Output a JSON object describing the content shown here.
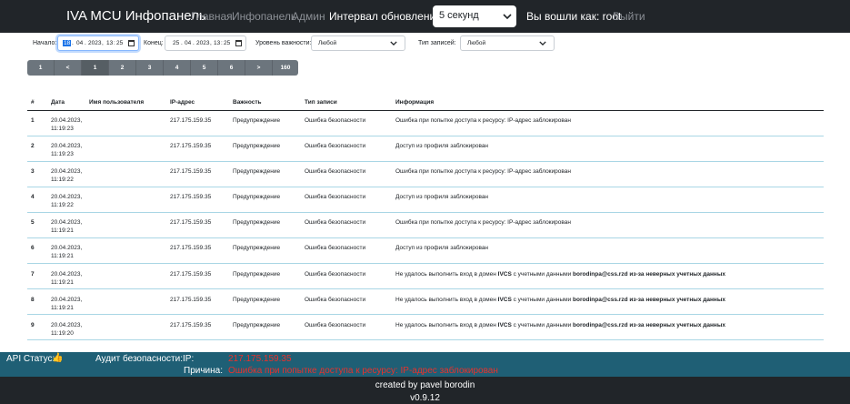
{
  "navbar": {
    "brand": "IVA MCU Инфопанель",
    "links": [
      "Главная",
      "Инфопанель",
      "Админ"
    ],
    "interval_label": "Интервал обновления:",
    "interval_value": "5 секунд",
    "logged_in": "Вы вошли как: root",
    "logout": "Выйти"
  },
  "filters": {
    "start_label": "Начало:",
    "start": {
      "day": "18",
      "month": "04",
      "year": "2023",
      "hour": "13",
      "minute": "25"
    },
    "end_label": "Конец:",
    "end": {
      "day": "25",
      "month": "04",
      "year": "2023",
      "hour": "13",
      "minute": "25"
    },
    "severity_label": "Уровень важности:",
    "severity_value": "Любой",
    "type_label": "Тип записей:",
    "type_value": "Любой",
    "sep_dot": ".",
    "sep_comma": ",",
    "sep_colon": ":"
  },
  "pagination": [
    "1",
    "<",
    "1",
    "2",
    "3",
    "4",
    "5",
    "6",
    ">",
    "160"
  ],
  "table": {
    "headers": [
      "#",
      "Дата",
      "Имя пользователя",
      "IP-адрес",
      "Важность",
      "Тип записи",
      "Информация"
    ],
    "rows": [
      {
        "num": "1",
        "date": "20.04.2023,",
        "time": "11:19:23",
        "user": "",
        "ip": "217.175.159.35",
        "severity": "Предупреждение",
        "type": "Ошибка безопасности",
        "info": "Ошибка при попытке доступа к ресурсу: IP-адрес заблокирован"
      },
      {
        "num": "2",
        "date": "20.04.2023,",
        "time": "11:19:23",
        "user": "",
        "ip": "217.175.159.35",
        "severity": "Предупреждение",
        "type": "Ошибка безопасности",
        "info": "Доступ из профиля заблокирован"
      },
      {
        "num": "3",
        "date": "20.04.2023,",
        "time": "11:19:22",
        "user": "",
        "ip": "217.175.159.35",
        "severity": "Предупреждение",
        "type": "Ошибка безопасности",
        "info": "Ошибка при попытке доступа к ресурсу: IP-адрес заблокирован"
      },
      {
        "num": "4",
        "date": "20.04.2023,",
        "time": "11:19:22",
        "user": "",
        "ip": "217.175.159.35",
        "severity": "Предупреждение",
        "type": "Ошибка безопасности",
        "info": "Доступ из профиля заблокирован"
      },
      {
        "num": "5",
        "date": "20.04.2023,",
        "time": "11:19:21",
        "user": "",
        "ip": "217.175.159.35",
        "severity": "Предупреждение",
        "type": "Ошибка безопасности",
        "info": "Ошибка при попытке доступа к ресурсу: IP-адрес заблокирован"
      },
      {
        "num": "6",
        "date": "20.04.2023,",
        "time": "11:19:21",
        "user": "",
        "ip": "217.175.159.35",
        "severity": "Предупреждение",
        "type": "Ошибка безопасности",
        "info": "Доступ из профиля заблокирован"
      },
      {
        "num": "7",
        "date": "20.04.2023,",
        "time": "11:19:21",
        "user": "",
        "ip": "217.175.159.35",
        "severity": "Предупреждение",
        "type": "Ошибка безопасности",
        "info_a": "Не удалось выполнить вход в домен",
        "info_domain": "IVCS",
        "info_b": "с учетными данными",
        "info_login": "borodinpa@css.rzd",
        "info_c": "из-за неверных учетных данных"
      },
      {
        "num": "8",
        "date": "20.04.2023,",
        "time": "11:19:21",
        "user": "",
        "ip": "217.175.159.35",
        "severity": "Предупреждение",
        "type": "Ошибка безопасности",
        "info_a": "Не удалось выполнить вход в домен",
        "info_domain": "IVCS",
        "info_b": "с учетными данными",
        "info_login": "borodinpa@css.rzd",
        "info_c": "из-за неверных учетных данных"
      },
      {
        "num": "9",
        "date": "20.04.2023,",
        "time": "11:19:20",
        "user": "",
        "ip": "217.175.159.35",
        "severity": "Предупреждение",
        "type": "Ошибка безопасности",
        "info_a": "Не удалось выполнить вход в домен",
        "info_domain": "IVCS",
        "info_b": "с учетными данными",
        "info_login": "borodinpa@css.rzd",
        "info_c": "из-за неверных учетных данных"
      }
    ]
  },
  "statusbar": {
    "api_label": "API Статус:",
    "api_emoji": "👍",
    "audit_label": "Аудит безопасности:",
    "ip_label": "IP:",
    "ip_value": "217.175.159.35",
    "reason_label": "Причина:",
    "reason_value": "Ошибка при попытке доступа к ресурсу: IP-адрес заблокирован"
  },
  "footer": {
    "credit": "created by pavel borodin",
    "version": "v0.9.12"
  },
  "colors": {
    "navbar_bg": "#212529",
    "statusbar_bg": "#1f5f75",
    "alert_red": "#e8322c",
    "pagination_bg": "#6c757d",
    "row_divider": "#a9d6e5"
  }
}
